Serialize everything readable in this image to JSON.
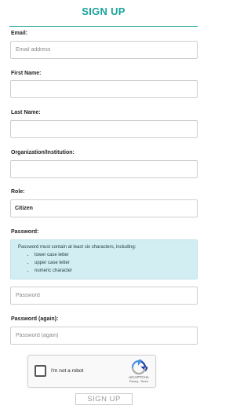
{
  "header": {
    "title": "SIGN UP"
  },
  "fields": {
    "email": {
      "label": "Email:",
      "placeholder": "Email address",
      "value": ""
    },
    "first_name": {
      "label": "First Name:",
      "value": ""
    },
    "last_name": {
      "label": "Last Name:",
      "value": ""
    },
    "organization": {
      "label": "Organization/Institution:",
      "value": ""
    },
    "role": {
      "label": "Role:",
      "selected": "Citizen"
    },
    "password": {
      "label": "Password:",
      "placeholder": "Password",
      "value": ""
    },
    "password_again": {
      "label": "Password (again):",
      "placeholder": "Password (again)",
      "value": ""
    }
  },
  "password_rules": {
    "intro": "Password must contain at least six characters, including:",
    "items": [
      "lower case letter",
      "upper case letter",
      "numeric character"
    ]
  },
  "recaptcha": {
    "label": "I'm not a robot",
    "brand": "reCAPTCHA",
    "links": "Privacy - Terms",
    "icon": "recaptcha-logo-icon"
  },
  "actions": {
    "submit_label": "SIGN UP"
  },
  "colors": {
    "accent": "#1aa39c",
    "info_bg": "#d3eef2"
  }
}
